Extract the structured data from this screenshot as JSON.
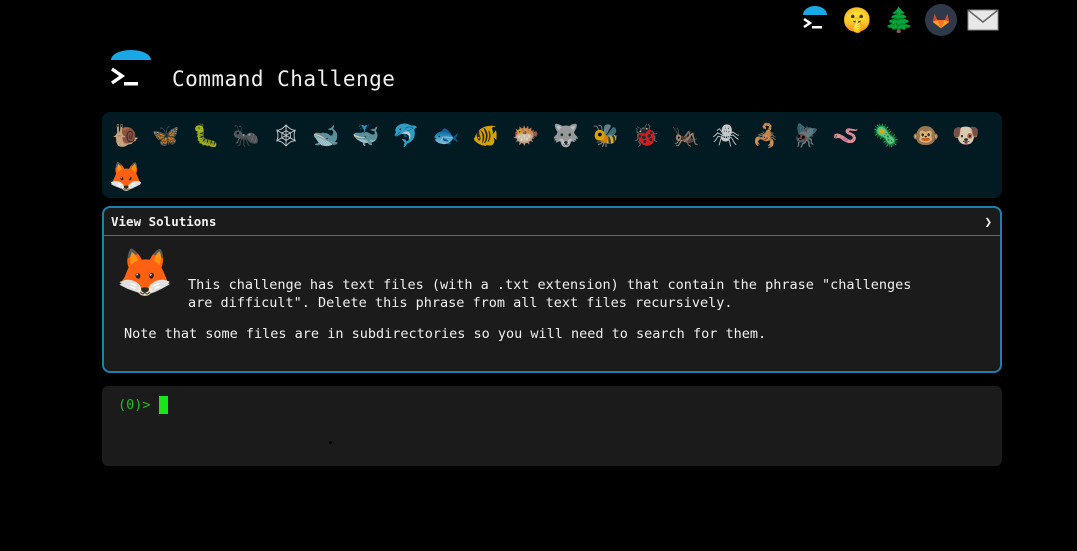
{
  "header": {
    "title": "Command Challenge"
  },
  "top_icons": [
    {
      "name": "terminal-icon",
      "glyph": "❯"
    },
    {
      "name": "shush-face-icon",
      "glyph": "🤫"
    },
    {
      "name": "tree-icon",
      "glyph": "🌲"
    },
    {
      "name": "gitlab-icon",
      "glyph": "🦊"
    },
    {
      "name": "mail-icon",
      "glyph": "✉"
    }
  ],
  "challenges": [
    {
      "name": "snail-icon",
      "glyph": "🐌"
    },
    {
      "name": "butterfly-icon",
      "glyph": "🦋"
    },
    {
      "name": "caterpillar-icon",
      "glyph": "🐛"
    },
    {
      "name": "ant-icon",
      "glyph": "🐜"
    },
    {
      "name": "spider-web-icon",
      "glyph": "🕸"
    },
    {
      "name": "whale-icon",
      "glyph": "🐋"
    },
    {
      "name": "spouting-whale-icon",
      "glyph": "🐳"
    },
    {
      "name": "dolphin-icon",
      "glyph": "🐬"
    },
    {
      "name": "fish-icon",
      "glyph": "🐟"
    },
    {
      "name": "tropical-fish-icon",
      "glyph": "🐠"
    },
    {
      "name": "blowfish-icon",
      "glyph": "🐡"
    },
    {
      "name": "wolf-icon",
      "glyph": "🐺"
    },
    {
      "name": "bee-icon",
      "glyph": "🐝"
    },
    {
      "name": "ladybug-icon",
      "glyph": "🐞"
    },
    {
      "name": "cricket-icon",
      "glyph": "🦗"
    },
    {
      "name": "spider-icon",
      "glyph": "🕷"
    },
    {
      "name": "scorpion-icon",
      "glyph": "🦂"
    },
    {
      "name": "fly-icon",
      "glyph": "🪰"
    },
    {
      "name": "worm-icon",
      "glyph": "🪱"
    },
    {
      "name": "microbe-icon",
      "glyph": "🦠"
    },
    {
      "name": "monkey-icon",
      "glyph": "🐵"
    },
    {
      "name": "dog-icon",
      "glyph": "🐶"
    },
    {
      "name": "fox-icon",
      "glyph": "🦊"
    }
  ],
  "panel": {
    "head_label": "View Solutions",
    "chevron": "❯",
    "description": "This challenge has text files (with a .txt extension) that contain the phrase \"challenges\nare difficult\". Delete this phrase from all text files recursively.",
    "note": "Note that some files are in subdirectories so you will need to search for them."
  },
  "terminal": {
    "prompt": "(0)>"
  },
  "colors": {
    "accent": "#1d7fae",
    "prompt": "#1fbf1f",
    "cursor": "#19e619",
    "bar_bg": "#021a22",
    "panel_bg": "#1b1b1b"
  }
}
